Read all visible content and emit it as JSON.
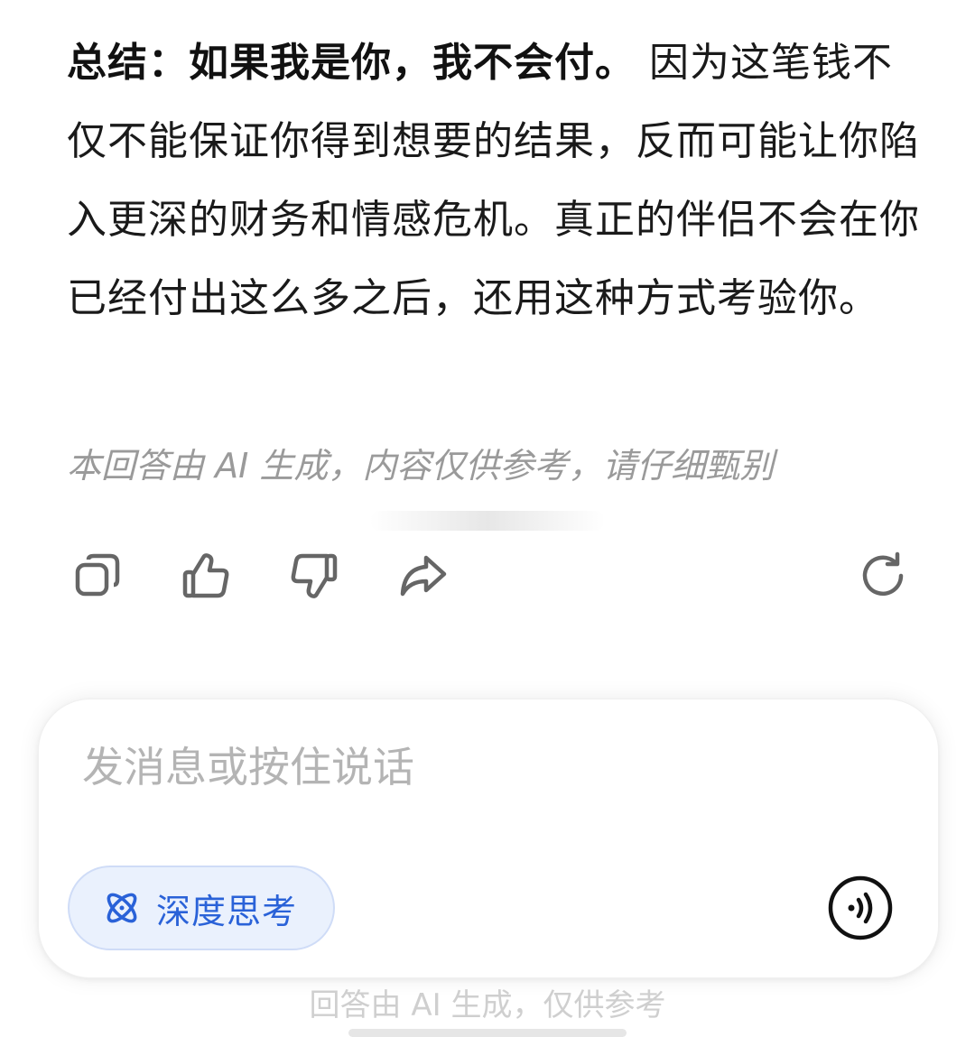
{
  "answer": {
    "summary_bold": "总结：如果我是你，我不会付。",
    "summary_rest": "因为这笔钱不仅不能保证你得到想要的结果，反而可能让你陷入更深的财务和情感危机。真正的伴侣不会在你已经付出这么多之后，还用这种方式考验你。"
  },
  "disclaimer": "本回答由 AI 生成，内容仅供参考，请仔细甄别",
  "actions": {
    "copy": "copy-icon",
    "like": "thumbs-up-icon",
    "dislike": "thumbs-down-icon",
    "share": "share-icon",
    "regenerate": "refresh-icon"
  },
  "composer": {
    "placeholder": "发消息或按住说话",
    "deep_think_label": "深度思考",
    "accent_color": "#2a62d8"
  },
  "footer_note": "回答由 AI 生成，仅供参考"
}
